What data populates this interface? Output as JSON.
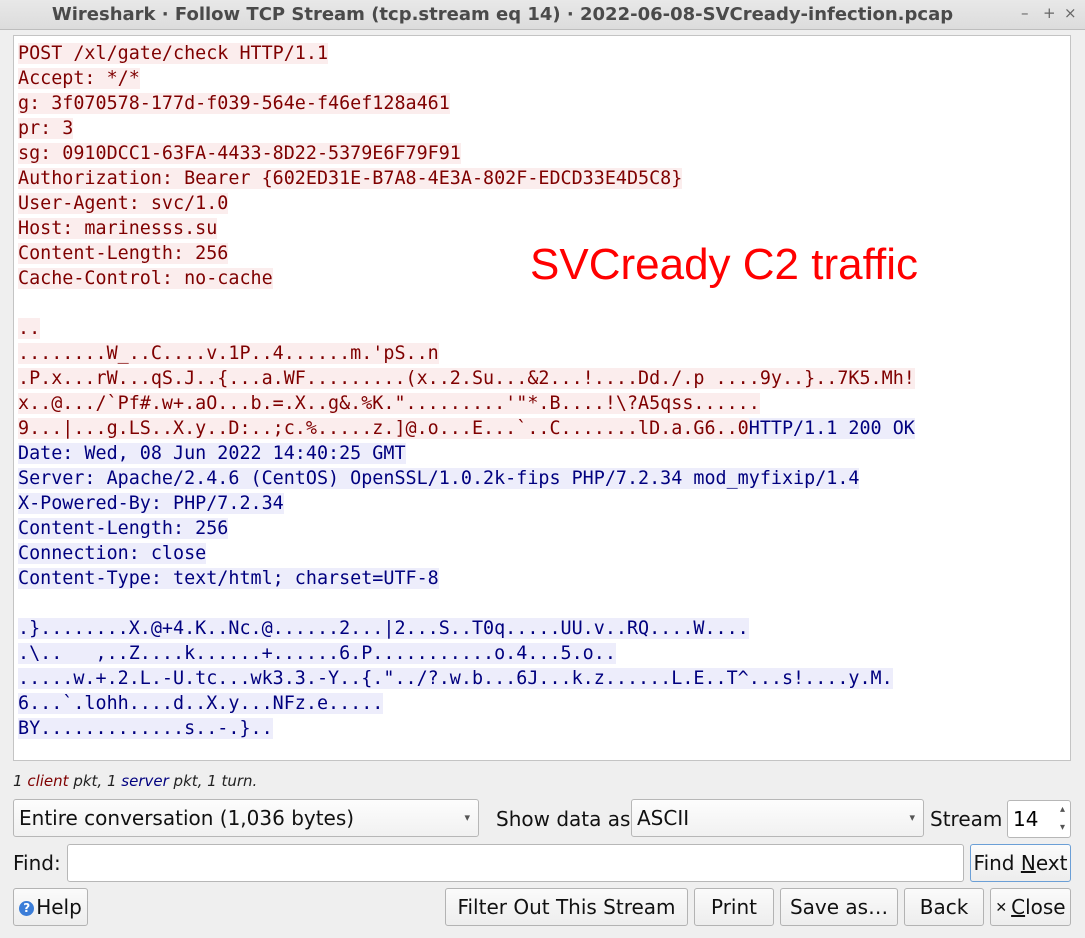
{
  "window": {
    "title": "Wireshark · Follow TCP Stream (tcp.stream eq 14) · 2022-06-08-SVCready-infection.pcap",
    "minimize_glyph": "–",
    "maximize_glyph": "+",
    "close_glyph": "×"
  },
  "stream": {
    "client_lines": [
      "POST /xl/gate/check HTTP/1.1",
      "Accept: */*",
      "g: 3f070578-177d-f039-564e-f46ef128a461",
      "pr: 3",
      "sg: 0910DCC1-63FA-4433-8D22-5379E6F79F91",
      "Authorization: Bearer {602ED31E-B7A8-4E3A-802F-EDCD33E4D5C8}",
      "User-Agent: svc/1.0",
      "Host: marinesss.su",
      "Content-Length: 256",
      "Cache-Control: no-cache",
      "",
      "..",
      "........W_..C....v.1P..4......m.'pS..n",
      ".P.x...rW...qS.J..{...a.WF.........(x..2.Su...&2...!....Dd./.p ....9y..}..7K5.Mh!",
      "x..@.../`Pf#.w+.aO...b.=.X..g&.%K.\".........'\"*.B....!\\?A5qss......"
    ],
    "mixed_line_client": "9...|...g.LS..X.y..D:..;c.%.....z.]@.o...E...`..C.......lD.a.G6..0",
    "mixed_line_server": "HTTP/1.1 200 OK",
    "server_lines": [
      "Date: Wed, 08 Jun 2022 14:40:25 GMT",
      "Server: Apache/2.4.6 (CentOS) OpenSSL/1.0.2k-fips PHP/7.2.34 mod_myfixip/1.4",
      "X-Powered-By: PHP/7.2.34",
      "Content-Length: 256",
      "Connection: close",
      "Content-Type: text/html; charset=UTF-8",
      "",
      ".}........X.@+4.K..Nc.@......2...|2...S..T0q.....UU.v..RQ....W....",
      ".\\..   ,..Z....k......+......6.P...........o.4...5.o..",
      ".....w.+.2.L.-U.tc...wk3.3.-Y..{.\"../?.w.b...6J...k.z......L.E..T^...s!....y.M.",
      "6...`.lohh....d..X.y...NFz.e.....",
      "BY.............s..-.}.."
    ]
  },
  "annotation": "SVCready C2 traffic",
  "stats": {
    "client_count": "1",
    "client_word": "client",
    "pkt_sep": "pkt,",
    "server_count": "1",
    "server_word": "server",
    "tail": "pkt, 1 turn."
  },
  "conversation_select": {
    "value": "Entire conversation (1,036 bytes)"
  },
  "show_data": {
    "label": "Show data as",
    "value": "ASCII"
  },
  "stream_spin": {
    "label": "Stream",
    "value": "14"
  },
  "find": {
    "label": "Find:",
    "value": "",
    "button_pre": "Find ",
    "button_mnemonic": "N",
    "button_post": "ext"
  },
  "buttons": {
    "help": "Help",
    "filter_out": "Filter Out This Stream",
    "print": "Print",
    "save_as": "Save as…",
    "back": "Back",
    "close_mnemonic": "C",
    "close_rest": "lose"
  },
  "icons": {
    "help": "help-icon",
    "close": "close-icon",
    "dropdown": "chevron-down-icon"
  },
  "colors": {
    "client_fg": "#7f0000",
    "client_bg": "#fbeded",
    "server_fg": "#00007f",
    "server_bg": "#ededfb",
    "annotation": "#ff0000"
  }
}
